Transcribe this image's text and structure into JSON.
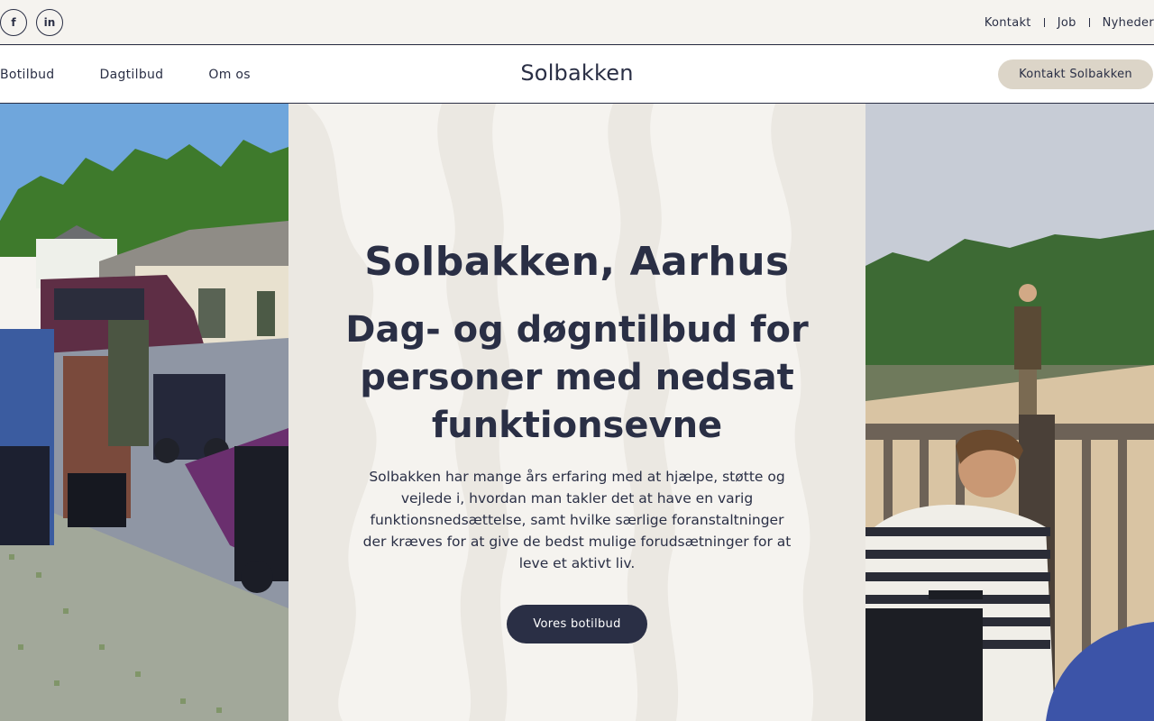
{
  "topbar": {
    "social": [
      {
        "icon": "facebook-icon",
        "glyph": "f"
      },
      {
        "icon": "linkedin-icon",
        "glyph": "in"
      }
    ],
    "links": [
      "Kontakt",
      "Job",
      "Nyheder"
    ]
  },
  "nav": {
    "items": [
      "Botilbud",
      "Dagtilbud",
      "Om os"
    ],
    "brand": "Solbakken",
    "cta_label": "Kontakt Solbakken"
  },
  "hero": {
    "title": "Solbakken, Aarhus",
    "subtitle": "Dag- og døgntilbud for personer med nedsat funktionsevne",
    "text": "Solbakken har mange års erfaring med at hjælpe, støtte og vejlede i, hvordan man takler det at have en varig funktionsnedsættelse, samt hvilke særlige foranstaltninger der kræves for at give de bedst mulige forudsætninger for at leve et aktivt liv.",
    "button_label": "Vores botilbud"
  },
  "colors": {
    "navy": "#2a2f45",
    "cream": "#f5f3ef",
    "beige_button": "#dcd5c8"
  }
}
